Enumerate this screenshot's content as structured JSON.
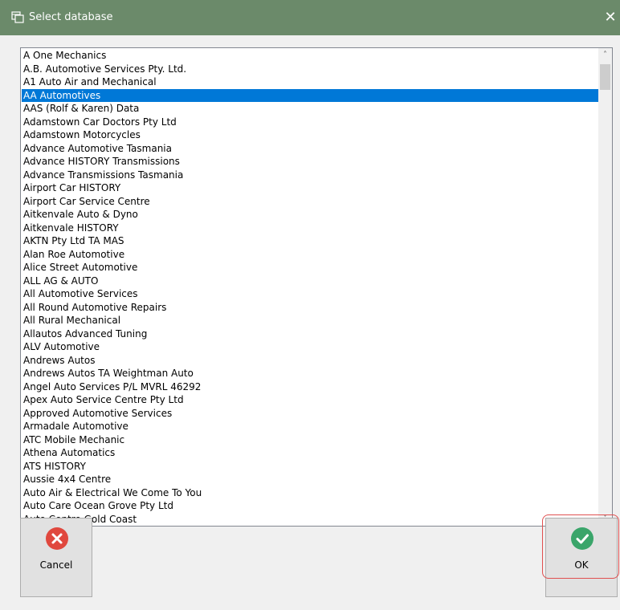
{
  "window": {
    "title": "Select database",
    "close_glyph": "✕"
  },
  "list": {
    "selected_index": 3,
    "items": [
      "A One Mechanics",
      "A.B. Automotive Services Pty. Ltd.",
      "A1 Auto Air and Mechanical",
      "AA Automotives",
      "AAS (Rolf & Karen) Data",
      "Adamstown Car Doctors Pty Ltd",
      "Adamstown Motorcycles",
      "Advance Automotive Tasmania",
      "Advance HISTORY Transmissions",
      "Advance Transmissions Tasmania",
      "Airport Car HISTORY",
      "Airport Car Service Centre",
      "Aitkenvale Auto & Dyno",
      "Aitkenvale HISTORY",
      "AKTN Pty Ltd TA MAS",
      "Alan Roe Automotive",
      "Alice Street Automotive",
      "ALL AG & AUTO",
      "All Automotive Services",
      "All Round Automotive Repairs",
      "All Rural Mechanical",
      "Allautos Advanced Tuning",
      "ALV Automotive",
      "Andrews Autos",
      "Andrews Autos TA Weightman Auto",
      "Angel Auto Services P/L MVRL 46292",
      "Apex Auto Service Centre Pty Ltd",
      "Approved Automotive Services",
      "Armadale Automotive",
      "ATC Mobile Mechanic",
      "Athena Automatics",
      "ATS HISTORY",
      "Aussie 4x4 Centre",
      "Auto Air & Electrical We Come To You",
      "Auto Care Ocean Grove Pty Ltd",
      "Auto Centre Gold Coast"
    ]
  },
  "scrollbar": {
    "up_glyph": "˄",
    "down_glyph": "˅"
  },
  "buttons": {
    "cancel_label": "Cancel",
    "ok_label": "OK"
  },
  "colors": {
    "titlebar": "#6b8a6a",
    "selection": "#0078d7",
    "cancel_icon": "#e0483e",
    "ok_icon": "#3aa56a",
    "ok_highlight": "#e05050"
  }
}
